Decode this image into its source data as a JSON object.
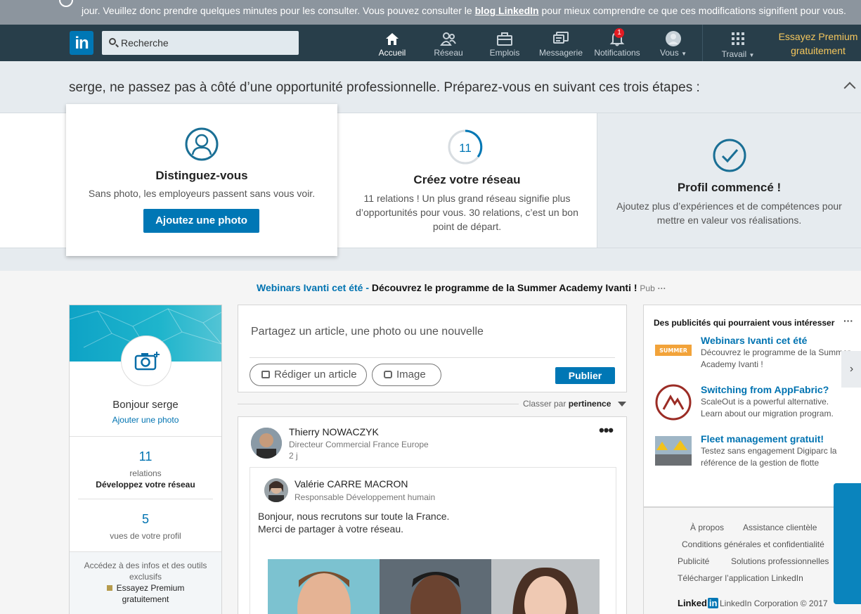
{
  "notice": {
    "line": "jour. Veuillez donc prendre quelques minutes pour les consulter. Vous pouvez consulter le",
    "link": "blog LinkedIn",
    "rest": "pour mieux comprendre ce que ces modifications signifient pour vous."
  },
  "nav": {
    "logo": "in",
    "search_placeholder": "Recherche",
    "items": [
      {
        "label": "Accueil",
        "icon": "home-icon"
      },
      {
        "label": "Réseau",
        "icon": "network-icon"
      },
      {
        "label": "Emplois",
        "icon": "briefcase-icon"
      },
      {
        "label": "Messagerie",
        "icon": "messages-icon"
      },
      {
        "label": "Notifications",
        "icon": "bell-icon",
        "badge": "1"
      },
      {
        "label": "Vous",
        "icon": "avatar-icon"
      },
      {
        "label": "Travail",
        "icon": "grid-icon"
      }
    ],
    "premium_line1": "Essayez Premium",
    "premium_line2": "gratuitement"
  },
  "onboarding": {
    "title": "serge, ne passez pas à côté d’une opportunité professionnelle. Préparez-vous en suivant ces trois étapes :",
    "cards": [
      {
        "heading": "Distinguez-vous",
        "text": "Sans photo, les employeurs passent sans vous voir.",
        "button": "Ajoutez une photo"
      },
      {
        "heading": "Créez votre réseau",
        "progress_value": "11",
        "text1": "11 relations ! Un plus grand réseau signifie plus",
        "text2": "d’opportunités pour vous. 30 relations, c’est un bon",
        "text3": "point de départ."
      },
      {
        "heading": "Profil commencé !",
        "text1": "Ajoutez plus d’expériences et de compétences pour",
        "text2": "mettre en valeur vos réalisations."
      }
    ]
  },
  "adline": {
    "sponsor": "Webinars Ivanti cet été -",
    "headline": "Découvrez le programme de la Summer Academy Ivanti !",
    "tag": "Pub",
    "menu": "···"
  },
  "profile": {
    "hello": "Bonjour serge",
    "add_photo": "Ajouter une photo",
    "relations_count": "11",
    "relations_label": "relations",
    "grow_network": "Développez votre réseau",
    "views_count": "5",
    "views_label": "vues de votre profil",
    "premium_text1": "Accédez à des infos et des outils",
    "premium_text2": "exclusifs",
    "premium_link1": "Essayez Premium",
    "premium_link2": "gratuitement"
  },
  "share": {
    "placeholder": "Partagez un article, une photo ou une nouvelle",
    "write_article": "Rédiger un article",
    "image": "Image",
    "publish": "Publier"
  },
  "sort": {
    "label": "Classer par",
    "value": "pertinence"
  },
  "post": {
    "author": "Thierry NOWACZYK",
    "title": "Directeur Commercial France Europe",
    "time": "2 j",
    "shared_author": "Valérie CARRE MACRON",
    "shared_title": "Responsable Développement humain",
    "line1": "Bonjour, nous recrutons sur toute la France.",
    "line2": "Merci de partager à votre réseau."
  },
  "right_ads": {
    "heading": "Des publicités qui pourraient vous intéresser",
    "menu": "···",
    "ads": [
      {
        "title": "Webinars Ivanti cet été",
        "desc": "Découvrez le programme de la Summer Academy Ivanti !"
      },
      {
        "title": "Switching from AppFabric?",
        "desc": "ScaleOut is a powerful alternative. Learn about our migration program."
      },
      {
        "title": "Fleet management gratuit!",
        "desc": "Testez sans engagement Digiparc la référence de la gestion de flotte"
      }
    ]
  },
  "footer": {
    "links": [
      "À propos",
      "Assistance clientèle",
      "Conditions générales et confidentialité",
      "Publicité",
      "Solutions professionnelles",
      "Télécharger l’application LinkedIn"
    ],
    "logo_text": "Linked",
    "logo_in": "in",
    "copyright": "LinkedIn Corporation © 2017"
  },
  "colors": {
    "linkedin_blue": "#0077b5",
    "nav_bg": "#283e4a",
    "premium_gold": "#f5c75d"
  }
}
